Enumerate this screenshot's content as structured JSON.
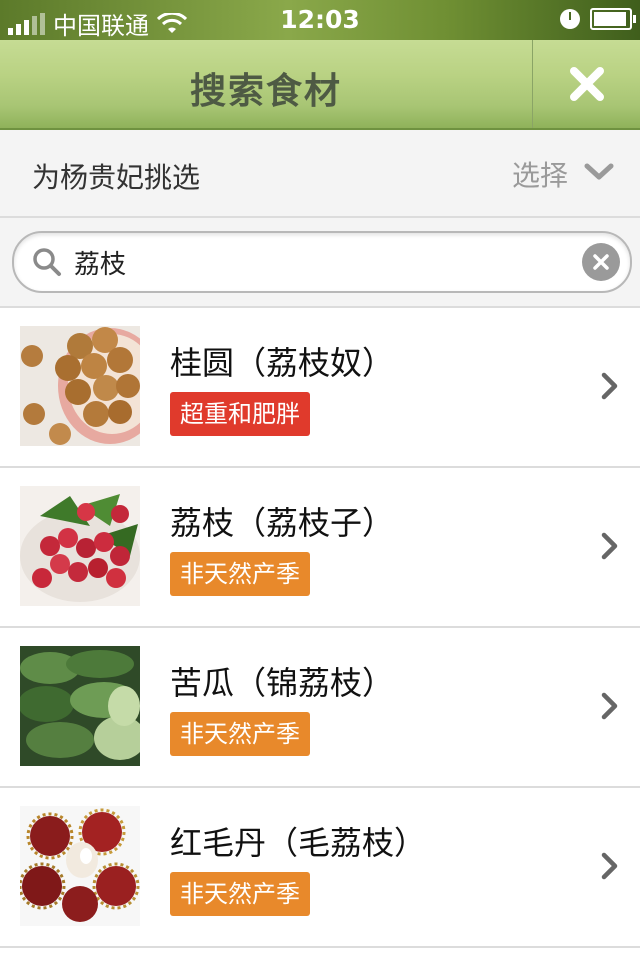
{
  "status_bar": {
    "carrier": "中国联通",
    "time": "12:03"
  },
  "header": {
    "title": "搜索食材",
    "close_icon": "close-icon"
  },
  "select_row": {
    "label": "为杨贵妃挑选",
    "action": "选择"
  },
  "search": {
    "value": "荔枝",
    "placeholder": ""
  },
  "colors": {
    "tag_red": "#e03a2c",
    "tag_orange": "#e8892b",
    "header_green": "#b9d283"
  },
  "items": [
    {
      "name": "桂圆（荔枝奴）",
      "tag": "超重和肥胖",
      "tag_color": "#e03a2c",
      "image": "longan-photo"
    },
    {
      "name": "荔枝（荔枝子）",
      "tag": "非天然产季",
      "tag_color": "#e8892b",
      "image": "lychee-photo"
    },
    {
      "name": "苦瓜（锦荔枝）",
      "tag": "非天然产季",
      "tag_color": "#e8892b",
      "image": "bitter-melon-photo"
    },
    {
      "name": "红毛丹（毛荔枝）",
      "tag": "非天然产季",
      "tag_color": "#e8892b",
      "image": "rambutan-photo"
    }
  ]
}
